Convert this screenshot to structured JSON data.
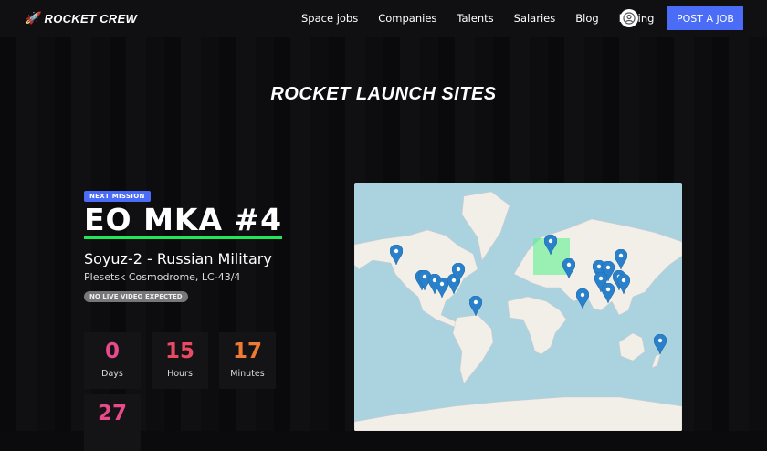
{
  "brand": {
    "name": "ROCKET CREW",
    "icon": "rocket-icon"
  },
  "nav": {
    "items": [
      "Space jobs",
      "Companies",
      "Talents",
      "Salaries",
      "Blog",
      "Pricing"
    ],
    "account_icon": "user-circle-icon",
    "post_job": "POST A JOB"
  },
  "page_title": "ROCKET LAUNCH SITES",
  "mission": {
    "badge": "NEXT MISSION",
    "name": "EO MKA #4",
    "rocket": "Soyuz-2 - Russian Military",
    "site": "Plesetsk Cosmodrome, LC-43/4",
    "video": "NO LIVE VIDEO EXPECTED"
  },
  "countdown": [
    {
      "value": "0",
      "label": "Days",
      "color": "#e84a8a"
    },
    {
      "value": "15",
      "label": "Hours",
      "color": "#ea4a64"
    },
    {
      "value": "17",
      "label": "Minutes",
      "color": "#ee7a33"
    },
    {
      "value": "27",
      "label": "",
      "color": "#e84a8a"
    }
  ],
  "colors": {
    "accent": "#4a6cf7",
    "underline": "#22e55a",
    "water": "#aad3df",
    "land": "#f2efe9",
    "pin": "#2a81cb"
  }
}
